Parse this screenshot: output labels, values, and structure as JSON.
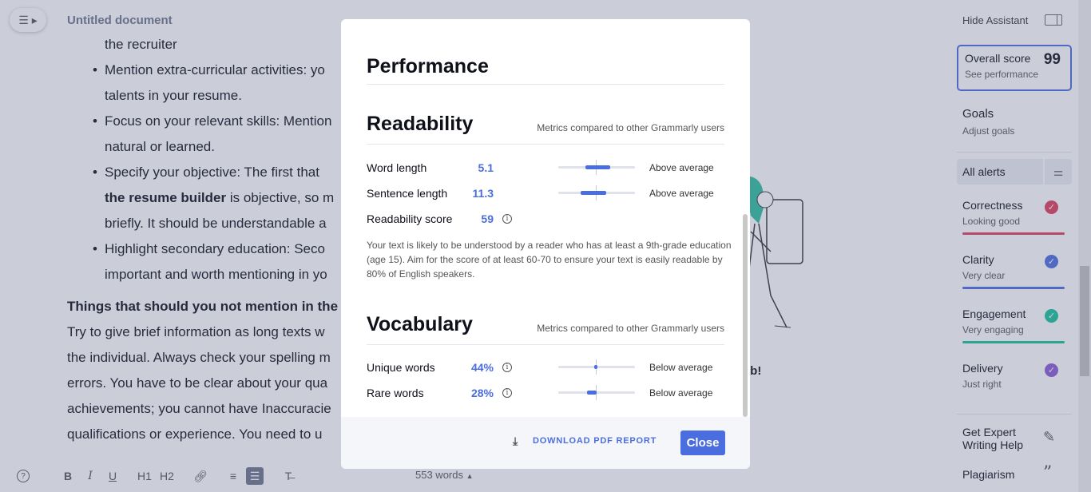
{
  "editor": {
    "doc_title": "Untitled document",
    "lines": {
      "l0": "the recruiter",
      "b1a": "Mention extra-curricular activities: yo",
      "b1b": "talents in your resume.",
      "b2a": "Focus on your relevant skills: Mention",
      "b2b": "natural or learned.",
      "b3a": "Specify your objective: The first that",
      "b3b_bold": "the resume builder",
      "b3b_rest": " is objective, so m",
      "b3c": "briefly. It should be understandable a",
      "b4a": "Highlight secondary education: Seco",
      "b4b": "important and worth mentioning in yo",
      "heading": "Things that should you not mention in the",
      "p1": "Try to give brief information as long texts w",
      "p2": "the individual. Always check your spelling m",
      "p3": "errors. You have to be clear about your qua",
      "p4": "achievements; you cannot have Inaccuracie",
      "p5": "qualifications or experience. You need to u"
    },
    "job_text": "ob!",
    "word_count": "553 words",
    "toolbar": {
      "bold": "B",
      "italic": "I",
      "underline": "U",
      "h1": "H1",
      "h2": "H2"
    }
  },
  "assistant": {
    "hide_label": "Hide Assistant",
    "overall_label": "Overall score",
    "overall_score": "99",
    "see_performance": "See performance",
    "goals_title": "Goals",
    "goals_sub": "Adjust goals",
    "all_alerts": "All alerts",
    "categories": [
      {
        "title": "Correctness",
        "status": "Looking good",
        "color": "#e03d5a"
      },
      {
        "title": "Clarity",
        "status": "Very clear",
        "color": "#4a6ee0"
      },
      {
        "title": "Engagement",
        "status": "Very engaging",
        "color": "#15c39a"
      },
      {
        "title": "Delivery",
        "status": "Just right",
        "color": "#8a5bd6"
      }
    ],
    "expert_line1": "Get Expert",
    "expert_line2": "Writing Help",
    "plagiarism": "Plagiarism"
  },
  "modal": {
    "performance_title": "Performance",
    "readability": {
      "title": "Readability",
      "note": "Metrics compared to other Grammarly users",
      "metrics": [
        {
          "label": "Word length",
          "value": "5.1",
          "rank": "Above average",
          "level": 0.68
        },
        {
          "label": "Sentence length",
          "value": "11.3",
          "rank": "Above average",
          "level": 0.62
        }
      ],
      "score_label": "Readability score",
      "score_value": "59",
      "explanation": "Your text is likely to be understood by a reader who has at least a 9th-grade education (age 15). Aim for the score of at least 60-70 to ensure your text is easily readable by 80% of English speakers."
    },
    "vocabulary": {
      "title": "Vocabulary",
      "note": "Metrics compared to other Grammarly users",
      "metrics": [
        {
          "label": "Unique words",
          "value": "44%",
          "rank": "Below average",
          "level": 0.47
        },
        {
          "label": "Rare words",
          "value": "28%",
          "rank": "Below average",
          "level": 0.38
        }
      ]
    },
    "download_label": "DOWNLOAD PDF REPORT",
    "close_label": "Close"
  }
}
